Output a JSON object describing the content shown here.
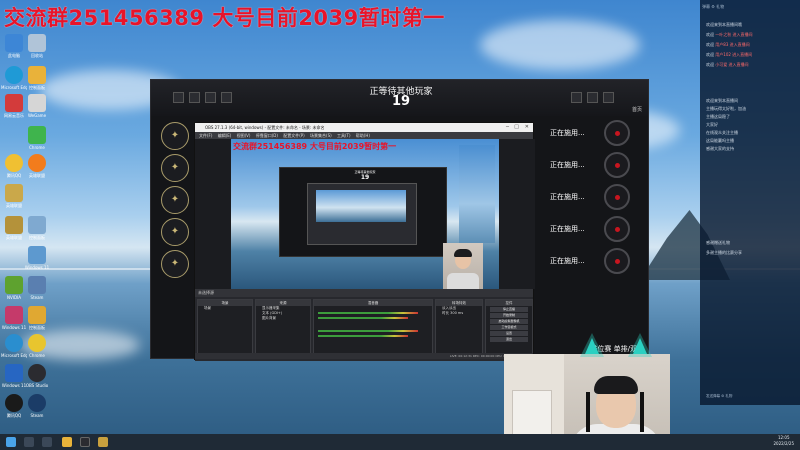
{
  "banner": {
    "text": "交流群251456389 大号目前2039暂时第一"
  },
  "game": {
    "waiting_text": "正等待其他玩家",
    "count": "19",
    "players": [
      "正在施用...",
      "正在施用...",
      "正在施用...",
      "正在施用...",
      "正在施用..."
    ],
    "bottom_text": "排位赛 单排/双排",
    "topright_label": "首页"
  },
  "obs": {
    "title": "OBS 27.1.3 (64-bit, windows) - 配置文件: 未命名 - 场景: 未命名",
    "menu": "文件(F) 编辑(E) 视图(V) 停靠窗口(D) 配置文件(P) 场景集合(S) 工具(T) 帮助(H)",
    "nested_banner": "交流群251456389 大号目前2039暂时第一",
    "nested_waiting": "正等待其他玩家",
    "nested_count": "19",
    "bar_label": "未选择源",
    "panels": {
      "scenes_header": "场景",
      "scenes": [
        "场景"
      ],
      "sources_header": "来源",
      "sources": [
        "显示器采集",
        "文本 (GDI+)",
        "图片背景"
      ],
      "mixer_header": "混音器",
      "transitions_header": "转场特效",
      "transition_value": "淡入淡出",
      "duration_label": "时长",
      "duration_value": "300 ms",
      "controls_header": "控件",
      "controls": [
        "停止直播",
        "开始录制",
        "启动虚拟摄像机",
        "工作室模式",
        "设置",
        "退出"
      ]
    },
    "status": "LIVE: 00:12:31   REC: 00:00:00   CPU: 6.1%, 60.00 fps"
  },
  "chat": {
    "top": "弹幕  ⚙  礼物",
    "messages": [
      {
        "text": "欢迎来到本直播间哦",
        "hl": ""
      },
      {
        "text": "欢迎 ",
        "hl": "一叶之秋 进入直播间"
      },
      {
        "text": "欢迎 ",
        "hl": "用户83 进入直播间"
      },
      {
        "text": "欢迎 ",
        "hl": "用户102 进入直播间"
      },
      {
        "text": "欢迎 ",
        "hl": "小可爱 进入直播间"
      },
      {
        "text": "欢迎来到本直播间",
        "hl": ""
      },
      {
        "text": "主播玩得太好啦，加油",
        "hl": ""
      },
      {
        "text": "主播这局稳了",
        "hl": ""
      },
      {
        "text": "大家好",
        "hl": ""
      },
      {
        "text": "在线观众关注主播",
        "hl": ""
      },
      {
        "text": "这局能赢吗主播",
        "hl": ""
      },
      {
        "text": "感谢大家的支持",
        "hl": ""
      },
      {
        "text": "感谢赠送礼物",
        "hl": ""
      },
      {
        "text": "多谢主播的比赛分享",
        "hl": ""
      }
    ],
    "footer": "发送弹幕    ⚙  礼物"
  },
  "taskbar": {
    "time": "12:05",
    "date": "2022/2/25"
  },
  "desktop_icons": [
    "此电脑",
    "回收站",
    "Microsoft Edge",
    "控制面板",
    "Steam",
    "网易云音乐",
    "WeGame",
    "腾讯QQ",
    "微信",
    "NVIDIA",
    "OBS Studio",
    "Windows 11",
    "Chrome",
    "英雄联盟",
    "Steam"
  ]
}
